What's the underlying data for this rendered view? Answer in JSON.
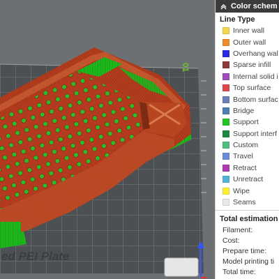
{
  "color_scheme": {
    "title": "Color schem",
    "section": "Line Type",
    "items": [
      {
        "label": "Inner wall",
        "color": "#f2d64b",
        "icon": "swatch-inner-wall"
      },
      {
        "label": "Outer wall",
        "color": "#f08a2b",
        "icon": "swatch-outer-wall"
      },
      {
        "label": "Overhang wal",
        "color": "#2a2ae0",
        "icon": "swatch-overhang-wall"
      },
      {
        "label": "Sparse infill",
        "color": "#8c3a3a",
        "icon": "swatch-sparse-infill"
      },
      {
        "label": "Internal solid i",
        "color": "#a04cc0",
        "icon": "swatch-internal-solid-infill"
      },
      {
        "label": "Top surface",
        "color": "#e0474c",
        "icon": "swatch-top-surface"
      },
      {
        "label": "Bottom surfac",
        "color": "#6b7fb8",
        "icon": "swatch-bottom-surface"
      },
      {
        "label": "Bridge",
        "color": "#4e7fb4",
        "icon": "swatch-bridge"
      },
      {
        "label": "Support",
        "color": "#22c522",
        "icon": "swatch-support"
      },
      {
        "label": "Support interf",
        "color": "#1f8a3c",
        "icon": "swatch-support-interface"
      },
      {
        "label": "Custom",
        "color": "#4fbf7f",
        "icon": "swatch-custom"
      },
      {
        "label": "Travel",
        "color": "#6a8cd8",
        "icon": "swatch-travel"
      },
      {
        "label": "Retract",
        "color": "#b03ab0",
        "icon": "swatch-retract"
      },
      {
        "label": "Unretract",
        "color": "#52b3d9",
        "icon": "swatch-unretract"
      },
      {
        "label": "Wipe",
        "color": "#ffee33",
        "icon": "swatch-wipe"
      },
      {
        "label": "Seams",
        "color": "#e8e8e8",
        "icon": "swatch-seams"
      }
    ]
  },
  "estimation": {
    "title": "Total estimation",
    "rows": [
      "Filament:",
      "Cost:",
      "Prepare time:",
      "Model printing ti",
      "Total time:"
    ]
  },
  "plate": {
    "label": "ed PEI Plate",
    "axis_label": "01"
  },
  "icons": {
    "collapse": "chevron-up-icon",
    "axis_y": "y-axis-arrow-icon"
  }
}
